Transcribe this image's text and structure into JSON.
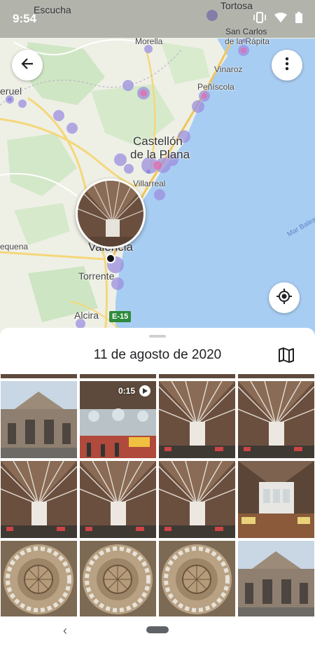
{
  "status_bar": {
    "time": "9:54",
    "icons": [
      "vibrate-icon",
      "wifi-icon",
      "battery-icon"
    ]
  },
  "map": {
    "labels": {
      "escucha": "Escucha",
      "tortosa": "Tortosa",
      "morella": "Morella",
      "san_carlos": "San Carlos",
      "rapita": "de la Rápita",
      "teruel": "eruel",
      "vinaroz": "Vinaroz",
      "peniscola": "Peñíscola",
      "castellon": "Castellón",
      "la_plana": "de la Plana",
      "villarreal": "Villarreal",
      "requena": "equena",
      "valencia": "Valencia",
      "torrente": "Torrente",
      "alcira": "Alcira",
      "mar_balear": "Mar Balear"
    },
    "highway": "E-15",
    "back_icon": "arrow-back-icon",
    "menu_icon": "more-vert-icon",
    "locate_icon": "my-location-icon"
  },
  "sheet": {
    "date": "11 de agosto de 2020",
    "map_toggle_icon": "map-icon"
  },
  "video": {
    "duration": "0:15"
  },
  "photos": [
    "market-exterior",
    "market-video",
    "market-roof",
    "market-roof",
    "market-roof",
    "market-roof",
    "market-roof",
    "market-stalls",
    "dome",
    "dome",
    "dome",
    "market-exterior"
  ],
  "colors": {
    "water": "#a8cdf2",
    "land": "#eef0e6",
    "heat": "#9c8fe0",
    "accent": "#1a73e8"
  }
}
